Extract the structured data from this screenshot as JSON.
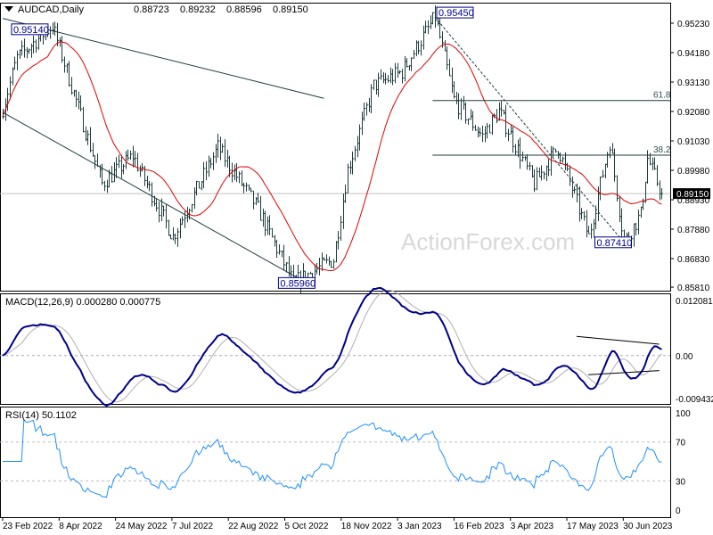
{
  "chart_data": {
    "type": "ohlc",
    "symbol": "AUDCAD,Daily",
    "ohlc_header": [
      "0.88723",
      "0.89232",
      "0.88596",
      "0.89150"
    ],
    "price_axis": {
      "ticks": [
        "0.95230",
        "0.94180",
        "0.93130",
        "0.92080",
        "0.91030",
        "0.89980",
        "0.88930",
        "0.87880",
        "0.86830",
        "0.85810"
      ],
      "range": [
        0.8581,
        0.9523
      ]
    },
    "current_price": "0.89150",
    "date_labels": [
      "23 Feb 2022",
      "8 Apr 2022",
      "24 May 2022",
      "7 Jul 2022",
      "22 Aug 2022",
      "5 Oct 2022",
      "18 Nov 2022",
      "3 Jan 2023",
      "16 Feb 2023",
      "3 Apr 2023",
      "17 May 2023",
      "30 Jun 2023"
    ],
    "bar_count": 280,
    "close_waypoints": [
      [
        0,
        0.922
      ],
      [
        6,
        0.94
      ],
      [
        21,
        0.9514
      ],
      [
        29,
        0.93
      ],
      [
        42,
        0.895
      ],
      [
        55,
        0.905
      ],
      [
        72,
        0.876
      ],
      [
        91,
        0.908
      ],
      [
        108,
        0.886
      ],
      [
        123,
        0.8596
      ],
      [
        140,
        0.868
      ],
      [
        146,
        0.9
      ],
      [
        157,
        0.93
      ],
      [
        169,
        0.935
      ],
      [
        183,
        0.9545
      ],
      [
        191,
        0.925
      ],
      [
        203,
        0.912
      ],
      [
        210,
        0.921
      ],
      [
        225,
        0.895
      ],
      [
        235,
        0.908
      ],
      [
        248,
        0.876
      ],
      [
        257,
        0.91
      ],
      [
        263,
        0.8741
      ],
      [
        270,
        0.884
      ],
      [
        273,
        0.904
      ],
      [
        279,
        0.8915
      ]
    ],
    "annotations": {
      "labels": [
        {
          "bar": 3,
          "price": "0.95140"
        },
        {
          "bar": 183,
          "price": "0.95450"
        },
        {
          "bar": 116,
          "price": "0.85960"
        },
        {
          "bar": 250,
          "price": "0.87410"
        }
      ],
      "fib": [
        {
          "label": "61.8",
          "price": 0.9247
        },
        {
          "label": "38.2",
          "price": 0.9052
        }
      ],
      "channel_upper": [
        [
          0,
          0.954
        ],
        [
          136,
          0.9255
        ]
      ],
      "channel_lower": [
        [
          0,
          0.9205
        ],
        [
          130,
          0.859
        ]
      ],
      "trend_dashed": [
        [
          183,
          0.9545
        ],
        [
          263,
          0.8741
        ]
      ]
    },
    "watermark": "ActionForex.com",
    "macd": {
      "label": "MACD(12,26,9) 0.000280 0.000775",
      "ticks": [
        "0.012081",
        "0.00",
        "-0.009432"
      ],
      "range": [
        -0.009432,
        0.012081
      ]
    },
    "rsi": {
      "label": "RSI(14) 50.1102",
      "ticks": [
        "100",
        "70",
        "30",
        "0"
      ],
      "range": [
        0,
        100
      ]
    },
    "colors": {
      "bars": "#1f3d3d",
      "ma": "#e00000",
      "macd": "#00008b",
      "signal": "#b0b0b0",
      "rsi": "#1e90ff",
      "label_border": "#00008b"
    }
  }
}
